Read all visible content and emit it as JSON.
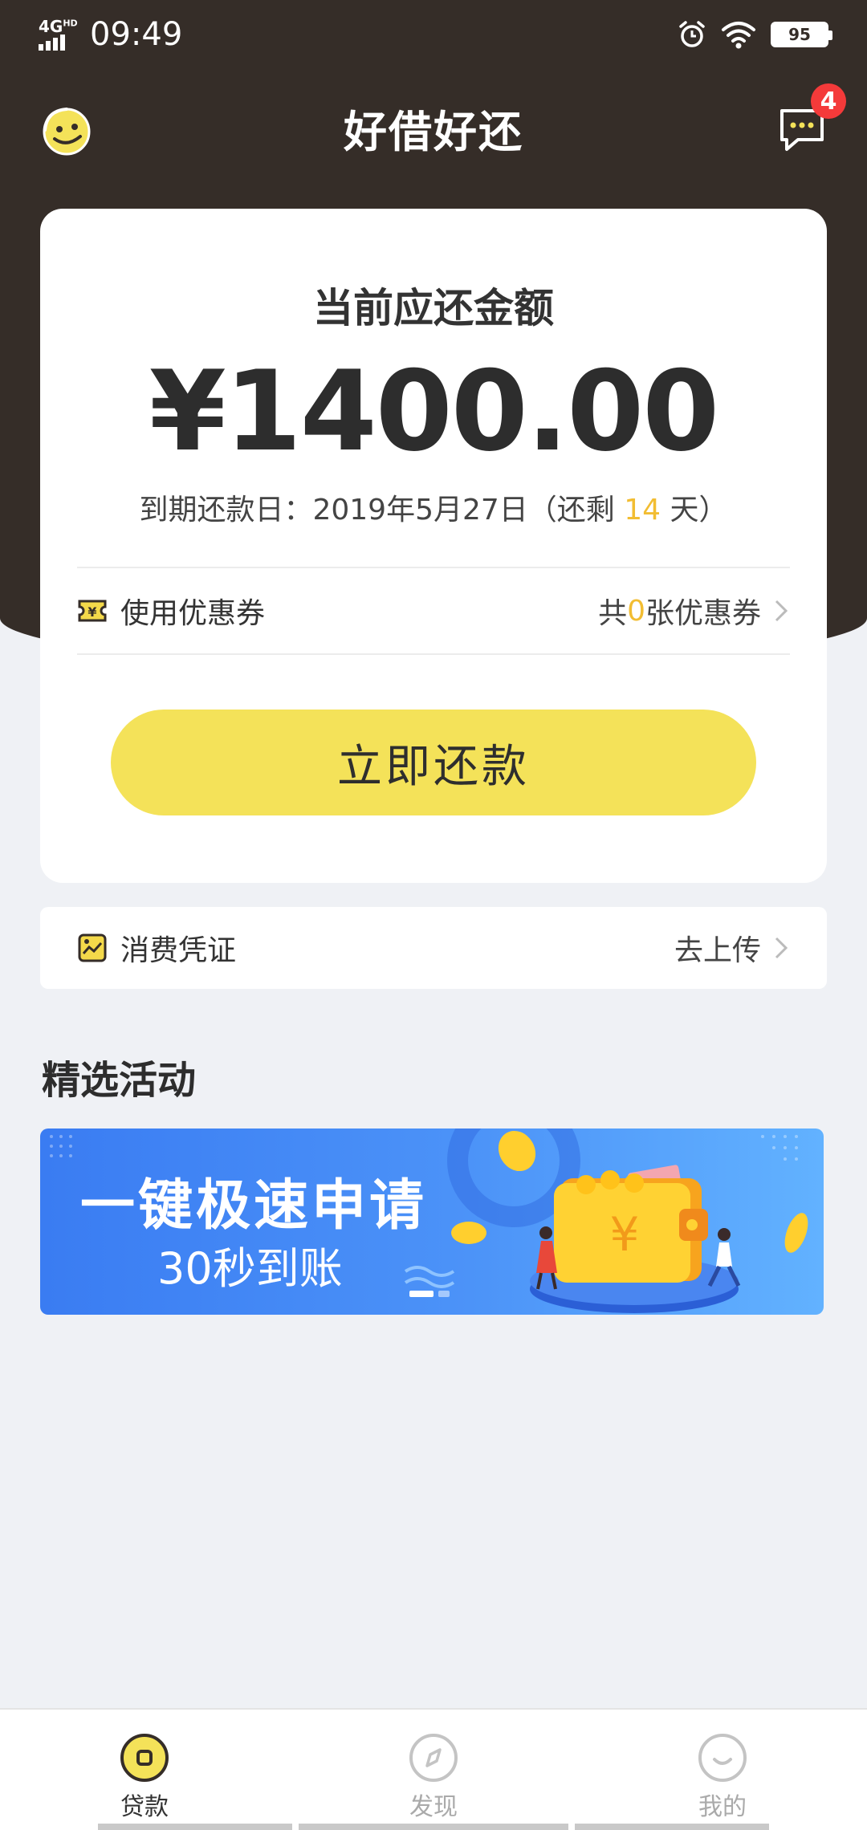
{
  "status_bar": {
    "network": "4G",
    "network_suffix": "HD",
    "time": "09:49",
    "battery": "95"
  },
  "header": {
    "title": "好借好还",
    "message_badge": "4"
  },
  "repay_card": {
    "label": "当前应还金额",
    "amount": "¥1400.00",
    "due_prefix": "到期还款日：2019年5月27日（还剩 ",
    "days_left": "14",
    "due_suffix": " 天）",
    "coupon_label": "使用优惠券",
    "coupon_prefix": "共 ",
    "coupon_count": "0",
    "coupon_suffix": " 张优惠券",
    "pay_button": "立即还款"
  },
  "voucher": {
    "label": "消费凭证",
    "action": "去上传"
  },
  "activities": {
    "title": "精选活动",
    "banner_line1": "一键极速申请",
    "banner_line2": "30秒到账",
    "wallet_symbol": "¥"
  },
  "tabs": [
    {
      "label": "贷款",
      "active": true
    },
    {
      "label": "发现",
      "active": false
    },
    {
      "label": "我的",
      "active": false
    }
  ],
  "colors": {
    "header_bg": "#352d28",
    "accent_yellow": "#f4e259",
    "highlight": "#f2bd32",
    "badge_red": "#f43a3a"
  }
}
